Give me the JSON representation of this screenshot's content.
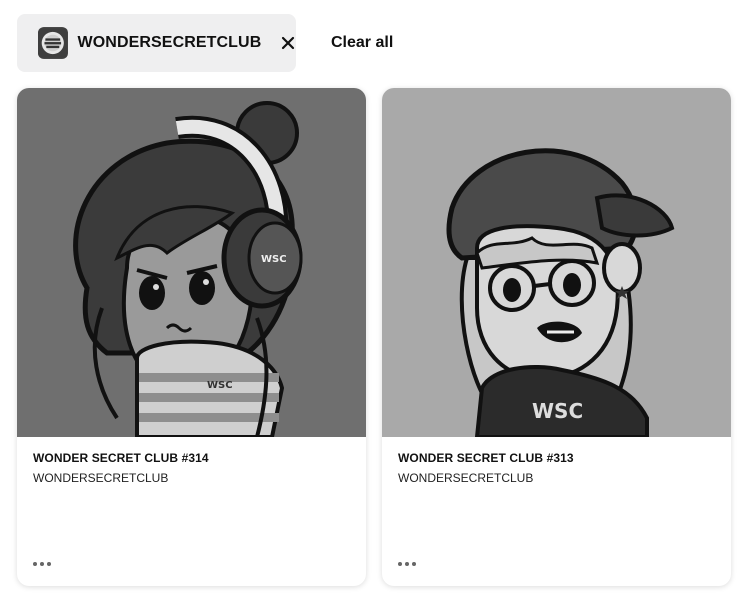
{
  "filters": {
    "active_chip": {
      "label": "WONDERSECRETCLUB",
      "avatar_icon": "collection-logo-icon",
      "avatar_logo_text": "WONDER SECRET CLUB",
      "remove_icon": "close-icon"
    },
    "clear_all_label": "Clear all"
  },
  "cards": [
    {
      "title": "WONDER SECRET CLUB #314",
      "collection": "WONDERSECRETCLUB",
      "image_logo_text": [
        "WSC",
        "WSC"
      ],
      "menu_icon": "more-horizontal-icon"
    },
    {
      "title": "WONDER SECRET CLUB #313",
      "collection": "WONDERSECRETCLUB",
      "image_logo_text": [
        "WSC"
      ],
      "menu_icon": "more-horizontal-icon"
    }
  ],
  "colors": {
    "chip_background": "#efeff0",
    "card_1_image_background": "#6f6f6f",
    "card_2_image_background": "#a9a9a9",
    "text": "#111111"
  }
}
